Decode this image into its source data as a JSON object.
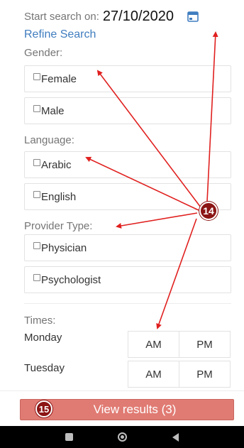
{
  "search": {
    "label": "Start search on:",
    "date_value": "27/10/2020",
    "calendar_icon": "calendar-icon"
  },
  "refine": {
    "label": "Refine Search"
  },
  "gender": {
    "label": "Gender:",
    "options": [
      "Female",
      "Male"
    ]
  },
  "language": {
    "label": "Language:",
    "options": [
      "Arabic",
      "English"
    ]
  },
  "provider_type": {
    "label": "Provider Type:",
    "options": [
      "Physician",
      "Psychologist"
    ]
  },
  "times": {
    "label": "Times:",
    "days": [
      {
        "day": "Monday",
        "am": "AM",
        "pm": "PM"
      },
      {
        "day": "Tuesday",
        "am": "AM",
        "pm": "PM"
      }
    ]
  },
  "view_results": {
    "badge": "15",
    "label": "View results (3)"
  },
  "annotation": {
    "badge": "14"
  },
  "colors": {
    "accent_link": "#3f7dbf",
    "button_bg": "#e07b73",
    "marker_bg": "#8b1414",
    "arrow": "#e0201f"
  },
  "navbar": {
    "icons": [
      "recent-apps-icon",
      "home-icon",
      "back-icon"
    ]
  }
}
